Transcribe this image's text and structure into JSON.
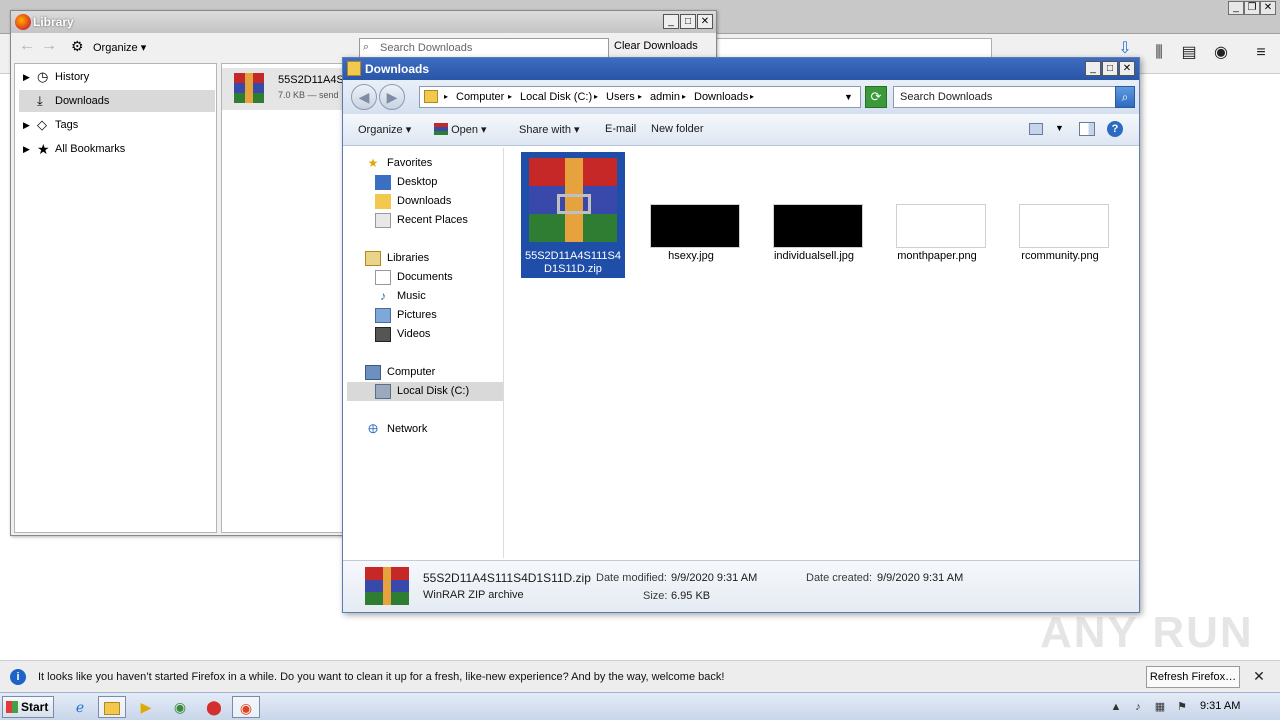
{
  "library": {
    "title": "Library",
    "organize": "Organize",
    "search_placeholder": "Search Downloads",
    "clear_downloads": "Clear Downloads",
    "tree": [
      {
        "label": "History",
        "icon": "clock-icon"
      },
      {
        "label": "Downloads",
        "icon": "download-icon"
      },
      {
        "label": "Tags",
        "icon": "tag-icon"
      },
      {
        "label": "All Bookmarks",
        "icon": "star-icon"
      }
    ],
    "download_item": {
      "name": "55S2D11A4S",
      "meta": "7.0 KB — send"
    }
  },
  "explorer": {
    "title": "Downloads",
    "address": [
      "Computer",
      "Local Disk (C:)",
      "Users",
      "admin",
      "Downloads"
    ],
    "search_placeholder": "Search Downloads",
    "commands": {
      "organize": "Organize",
      "open": "Open",
      "share": "Share with",
      "email": "E-mail",
      "new_folder": "New folder"
    },
    "nav": {
      "favorites": "Favorites",
      "desktop": "Desktop",
      "downloads": "Downloads",
      "recent": "Recent Places",
      "libraries": "Libraries",
      "documents": "Documents",
      "music": "Music",
      "pictures": "Pictures",
      "videos": "Videos",
      "computer": "Computer",
      "local_disk": "Local Disk (C:)",
      "network": "Network"
    },
    "files": [
      {
        "name": "55S2D11A4S111S4D1S11D.zip",
        "name_display": "55S2D11A4S111S4 D1S11D.zip"
      },
      {
        "name": "hsexy.jpg"
      },
      {
        "name": "individualsell.jpg"
      },
      {
        "name": "monthpaper.png"
      },
      {
        "name": "rcommunity.png"
      }
    ],
    "details": {
      "filename": "55S2D11A4S111S4D1S11D.zip",
      "type": "WinRAR ZIP archive",
      "modified_label": "Date modified:",
      "modified": "9/9/2020 9:31 AM",
      "created_label": "Date created:",
      "created": "9/9/2020 9:31 AM",
      "size_label": "Size:",
      "size": "6.95 KB"
    }
  },
  "notification": {
    "text": "It looks like you haven’t started Firefox in a while. Do you want to clean it up for a fresh, like-new experience? And by the way, welcome back!",
    "button": "Refresh Firefox…"
  },
  "taskbar": {
    "start": "Start",
    "clock": "9:31 AM"
  },
  "watermark": "ANY RUN",
  "colors": {
    "selection": "#1f4ea8",
    "titlebar": "#2a56a8"
  }
}
